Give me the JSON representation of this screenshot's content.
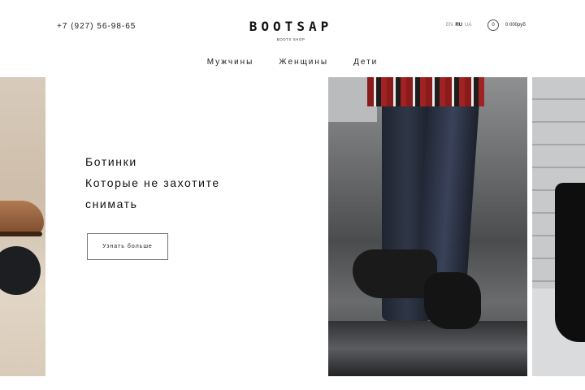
{
  "header": {
    "phone": "+7 (927) 56-98-65",
    "logo": "BOOTSAP",
    "logo_sub": "BOOTS SHOP",
    "languages": [
      "EN",
      "RU",
      "UA"
    ],
    "active_language": "RU",
    "cart_count": "0",
    "cart_total": "0 000руб"
  },
  "nav": {
    "items": [
      "Мужчины",
      "Женщины",
      "Дети"
    ]
  },
  "hero": {
    "line1": "Ботинки",
    "line2": "Которые не захотите",
    "line3": "снимать",
    "cta_label": "Узнать больше"
  },
  "colors": {
    "background": "#ffffff",
    "text": "#1a1a1a",
    "button_border": "#777777"
  },
  "images": {
    "left": "brown-leather-shoe-photo",
    "middle": "man-jeans-black-boots-wet-street-photo",
    "right": "black-heel-boots-photo"
  }
}
